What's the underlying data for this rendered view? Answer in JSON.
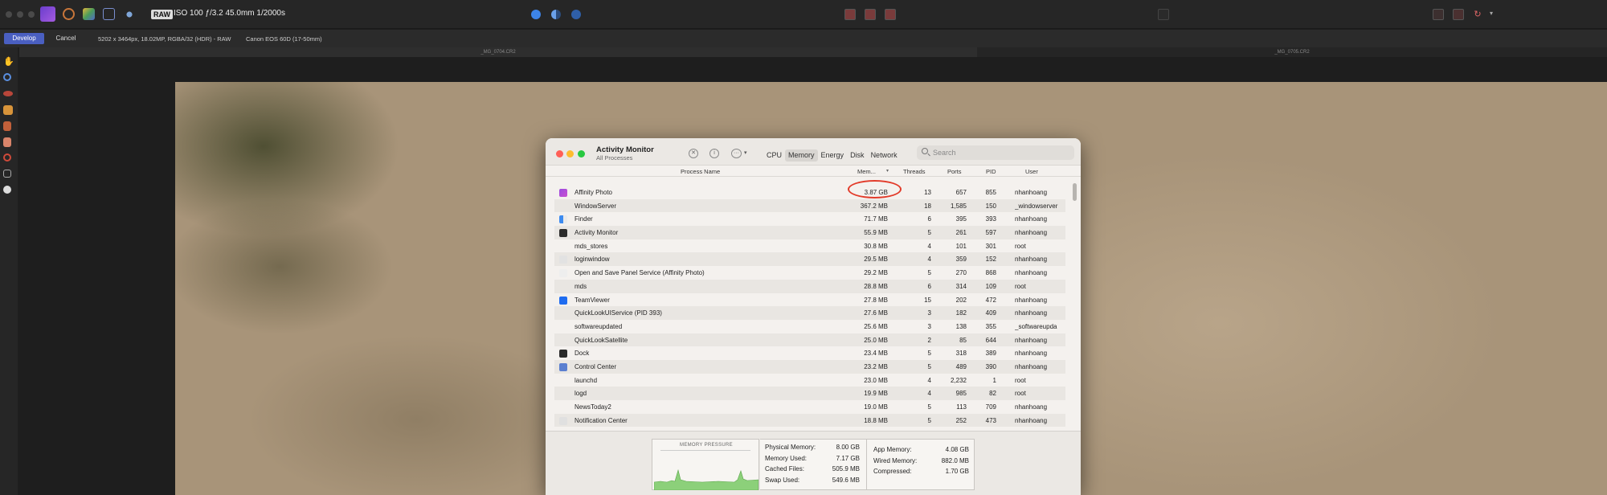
{
  "app": {
    "exif_badge": "RAW",
    "exif_text": "ISO 100 ƒ/3.2 45.0mm 1/2000s",
    "develop_label": "Develop",
    "cancel_label": "Cancel",
    "image_info": "5202 x 3464px, 18.02MP, RGBA/32 (HDR) - RAW",
    "lens_info": "Canon EOS 60D (17-50mm)",
    "tabs": [
      "_MG_0704.CR2",
      "_MG_0705.CR2"
    ]
  },
  "activity_monitor": {
    "title": "Activity Monitor",
    "subtitle": "All Processes",
    "tabs": [
      "CPU",
      "Memory",
      "Energy",
      "Disk",
      "Network"
    ],
    "active_tab": "Memory",
    "search_placeholder": "Search",
    "columns": {
      "name": "Process Name",
      "mem": "Mem...",
      "threads": "Threads",
      "ports": "Ports",
      "pid": "PID",
      "user": "User"
    },
    "rows": [
      {
        "name": "Affinity Photo",
        "mem": "3.87 GB",
        "threads": "13",
        "ports": "657",
        "pid": "855",
        "user": "nhanhoang",
        "icon": "affinity-photo-icon"
      },
      {
        "name": "WindowServer",
        "mem": "367.2 MB",
        "threads": "18",
        "ports": "1,585",
        "pid": "150",
        "user": "_windowserver",
        "icon": ""
      },
      {
        "name": "Finder",
        "mem": "71.7 MB",
        "threads": "6",
        "ports": "395",
        "pid": "393",
        "user": "nhanhoang",
        "icon": "finder-icon"
      },
      {
        "name": "Activity Monitor",
        "mem": "55.9 MB",
        "threads": "5",
        "ports": "261",
        "pid": "597",
        "user": "nhanhoang",
        "icon": "activity-monitor-icon"
      },
      {
        "name": "mds_stores",
        "mem": "30.8 MB",
        "threads": "4",
        "ports": "101",
        "pid": "301",
        "user": "root",
        "icon": ""
      },
      {
        "name": "loginwindow",
        "mem": "29.5 MB",
        "threads": "4",
        "ports": "359",
        "pid": "152",
        "user": "nhanhoang",
        "icon": "loginwindow-icon"
      },
      {
        "name": "Open and Save Panel Service (Affinity Photo)",
        "mem": "29.2 MB",
        "threads": "5",
        "ports": "270",
        "pid": "868",
        "user": "nhanhoang",
        "icon": "open-save-panel-icon"
      },
      {
        "name": "mds",
        "mem": "28.8 MB",
        "threads": "6",
        "ports": "314",
        "pid": "109",
        "user": "root",
        "icon": ""
      },
      {
        "name": "TeamViewer",
        "mem": "27.8 MB",
        "threads": "15",
        "ports": "202",
        "pid": "472",
        "user": "nhanhoang",
        "icon": "teamviewer-icon"
      },
      {
        "name": "QuickLookUIService (PID 393)",
        "mem": "27.6 MB",
        "threads": "3",
        "ports": "182",
        "pid": "409",
        "user": "nhanhoang",
        "icon": ""
      },
      {
        "name": "softwareupdated",
        "mem": "25.6 MB",
        "threads": "3",
        "ports": "138",
        "pid": "355",
        "user": "_softwareupda",
        "icon": ""
      },
      {
        "name": "QuickLookSatellite",
        "mem": "25.0 MB",
        "threads": "2",
        "ports": "85",
        "pid": "644",
        "user": "nhanhoang",
        "icon": ""
      },
      {
        "name": "Dock",
        "mem": "23.4 MB",
        "threads": "5",
        "ports": "318",
        "pid": "389",
        "user": "nhanhoang",
        "icon": "dock-icon"
      },
      {
        "name": "Control Center",
        "mem": "23.2 MB",
        "threads": "5",
        "ports": "489",
        "pid": "390",
        "user": "nhanhoang",
        "icon": "control-center-icon"
      },
      {
        "name": "launchd",
        "mem": "23.0 MB",
        "threads": "4",
        "ports": "2,232",
        "pid": "1",
        "user": "root",
        "icon": ""
      },
      {
        "name": "logd",
        "mem": "19.9 MB",
        "threads": "4",
        "ports": "985",
        "pid": "82",
        "user": "root",
        "icon": ""
      },
      {
        "name": "NewsToday2",
        "mem": "19.0 MB",
        "threads": "5",
        "ports": "113",
        "pid": "709",
        "user": "nhanhoang",
        "icon": ""
      },
      {
        "name": "Notification Center",
        "mem": "18.8 MB",
        "threads": "5",
        "ports": "252",
        "pid": "473",
        "user": "nhanhoang",
        "icon": "notification-center-icon"
      }
    ],
    "memory_pressure_title": "MEMORY PRESSURE",
    "stats_left": [
      {
        "label": "Physical Memory:",
        "value": "8.00 GB"
      },
      {
        "label": "Memory Used:",
        "value": "7.17 GB"
      },
      {
        "label": "Cached Files:",
        "value": "505.9 MB"
      },
      {
        "label": "Swap Used:",
        "value": "549.6 MB"
      }
    ],
    "stats_right": [
      {
        "label": "App Memory:",
        "value": "4.08 GB"
      },
      {
        "label": "Wired Memory:",
        "value": "882.0 MB"
      },
      {
        "label": "Compressed:",
        "value": "1.70 GB"
      }
    ]
  },
  "colors": {
    "accent_develop": "#4a5fc1",
    "memory_pressure_green": "#8cd07a",
    "highlight_circle": "#e23b2a"
  }
}
